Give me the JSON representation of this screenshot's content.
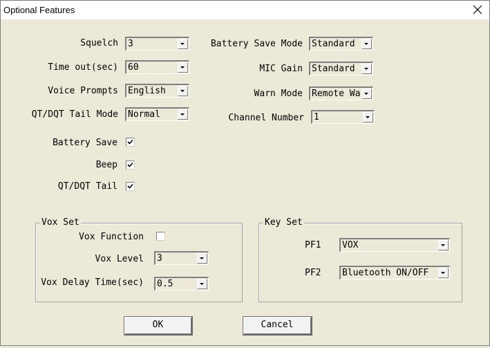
{
  "window": {
    "title": "Optional Features",
    "close_icon": "close-x-icon"
  },
  "left_fields": [
    {
      "label": "Squelch",
      "value": "3"
    },
    {
      "label": "Time out(sec)",
      "value": "60"
    },
    {
      "label": "Voice Prompts",
      "value": "English"
    },
    {
      "label": "QT/DQT Tail Mode",
      "value": "Normal"
    }
  ],
  "right_fields": [
    {
      "label": "Battery Save Mode",
      "value": "Standard"
    },
    {
      "label": "MIC Gain",
      "value": "Standard"
    },
    {
      "label": "Warn Mode",
      "value": "Remote Wa"
    },
    {
      "label": "Channel Number",
      "value": "1"
    }
  ],
  "checkboxes": [
    {
      "label": "Battery Save",
      "checked": true
    },
    {
      "label": "Beep",
      "checked": true
    },
    {
      "label": "QT/DQT Tail",
      "checked": true
    }
  ],
  "vox_set": {
    "title": "Vox Set",
    "function_label": "Vox Function",
    "function_checked": false,
    "level_label": "Vox Level",
    "level_value": "3",
    "delay_label": "Vox Delay Time(sec)",
    "delay_value": "0.5"
  },
  "key_set": {
    "title": "Key Set",
    "pf1_label": "PF1",
    "pf1_value": "VOX",
    "pf2_label": "PF2",
    "pf2_value": "Bluetooth ON/OFF"
  },
  "buttons": {
    "ok": "OK",
    "cancel": "Cancel"
  }
}
